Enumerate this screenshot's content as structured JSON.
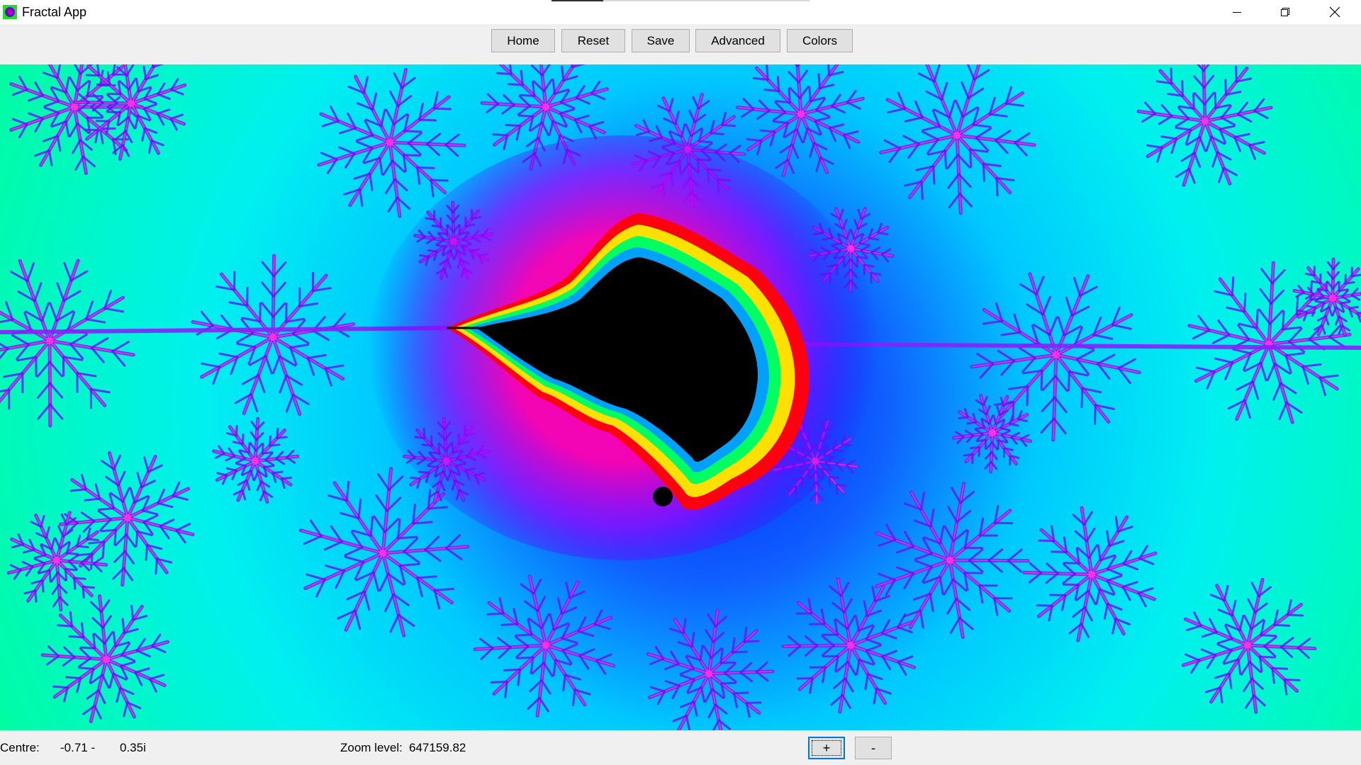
{
  "window": {
    "title": "Fractal App",
    "icon": "fractal-app-icon",
    "controls": [
      "minimize-icon",
      "restore-icon",
      "close-icon"
    ]
  },
  "toolbar": {
    "home_label": "Home",
    "reset_label": "Reset",
    "save_label": "Save",
    "advanced_label": "Advanced",
    "colors_label": "Colors"
  },
  "fractal": {
    "type": "Mandelbrot set",
    "palette": [
      "#000000",
      "#00ff80",
      "#ffff00",
      "#ff0000",
      "#ff00cc",
      "#8000ff",
      "#0000ff",
      "#00e8f0",
      "#00ff99"
    ]
  },
  "status": {
    "centre_label": "Centre:",
    "centre_real": "-0.71 -",
    "centre_imag": "0.35i",
    "zoom_label": "Zoom level:",
    "zoom_value": "647159.82",
    "zoom_in_label": "+",
    "zoom_out_label": "-"
  }
}
